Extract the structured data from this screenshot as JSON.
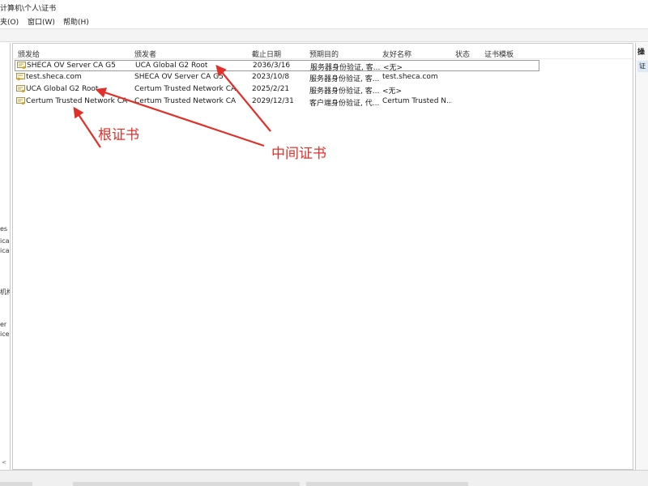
{
  "window": {
    "title_fragment": "计算机\\个人\\证书"
  },
  "menu": [
    {
      "label": "夹(O)"
    },
    {
      "label": "窗口(W)"
    },
    {
      "label": "帮助(H)"
    }
  ],
  "left_pane": {
    "fragments": [
      "es",
      "ica",
      "ica",
      "机构",
      "er",
      "ice"
    ]
  },
  "columns": [
    {
      "label": "颁发给"
    },
    {
      "label": "颁发者"
    },
    {
      "label": "截止日期"
    },
    {
      "label": "预期目的"
    },
    {
      "label": "友好名称"
    },
    {
      "label": "状态"
    },
    {
      "label": "证书模板"
    }
  ],
  "rows": [
    {
      "issued_to": "SHECA OV Server CA G5",
      "issued_by": "UCA Global G2 Root",
      "expiry": "2036/3/16",
      "purpose": "服务器身份验证, 客...",
      "friendly": "<无>",
      "status": "",
      "template": ""
    },
    {
      "issued_to": "test.sheca.com",
      "issued_by": "SHECA OV Server CA G5",
      "expiry": "2023/10/8",
      "purpose": "服务器身份验证, 客...",
      "friendly": "test.sheca.com",
      "status": "",
      "template": ""
    },
    {
      "issued_to": "UCA Global G2 Root",
      "issued_by": "Certum Trusted Network CA",
      "expiry": "2025/2/21",
      "purpose": "服务器身份验证, 客...",
      "friendly": "<无>",
      "status": "",
      "template": ""
    },
    {
      "issued_to": "Certum Trusted Network CA",
      "issued_by": "Certum Trusted Network CA",
      "expiry": "2029/12/31",
      "purpose": "客户端身份验证, 代...",
      "friendly": "Certum Trusted N...",
      "status": "",
      "template": ""
    }
  ],
  "right_pane": {
    "title": "操",
    "item": "证"
  },
  "annotations": {
    "root_label": "根证书",
    "intermediate_label": "中间证书",
    "color": "#e0302a"
  },
  "colors": {
    "selection_border": "#9a9a9a",
    "action_highlight": "#dce9f7"
  }
}
